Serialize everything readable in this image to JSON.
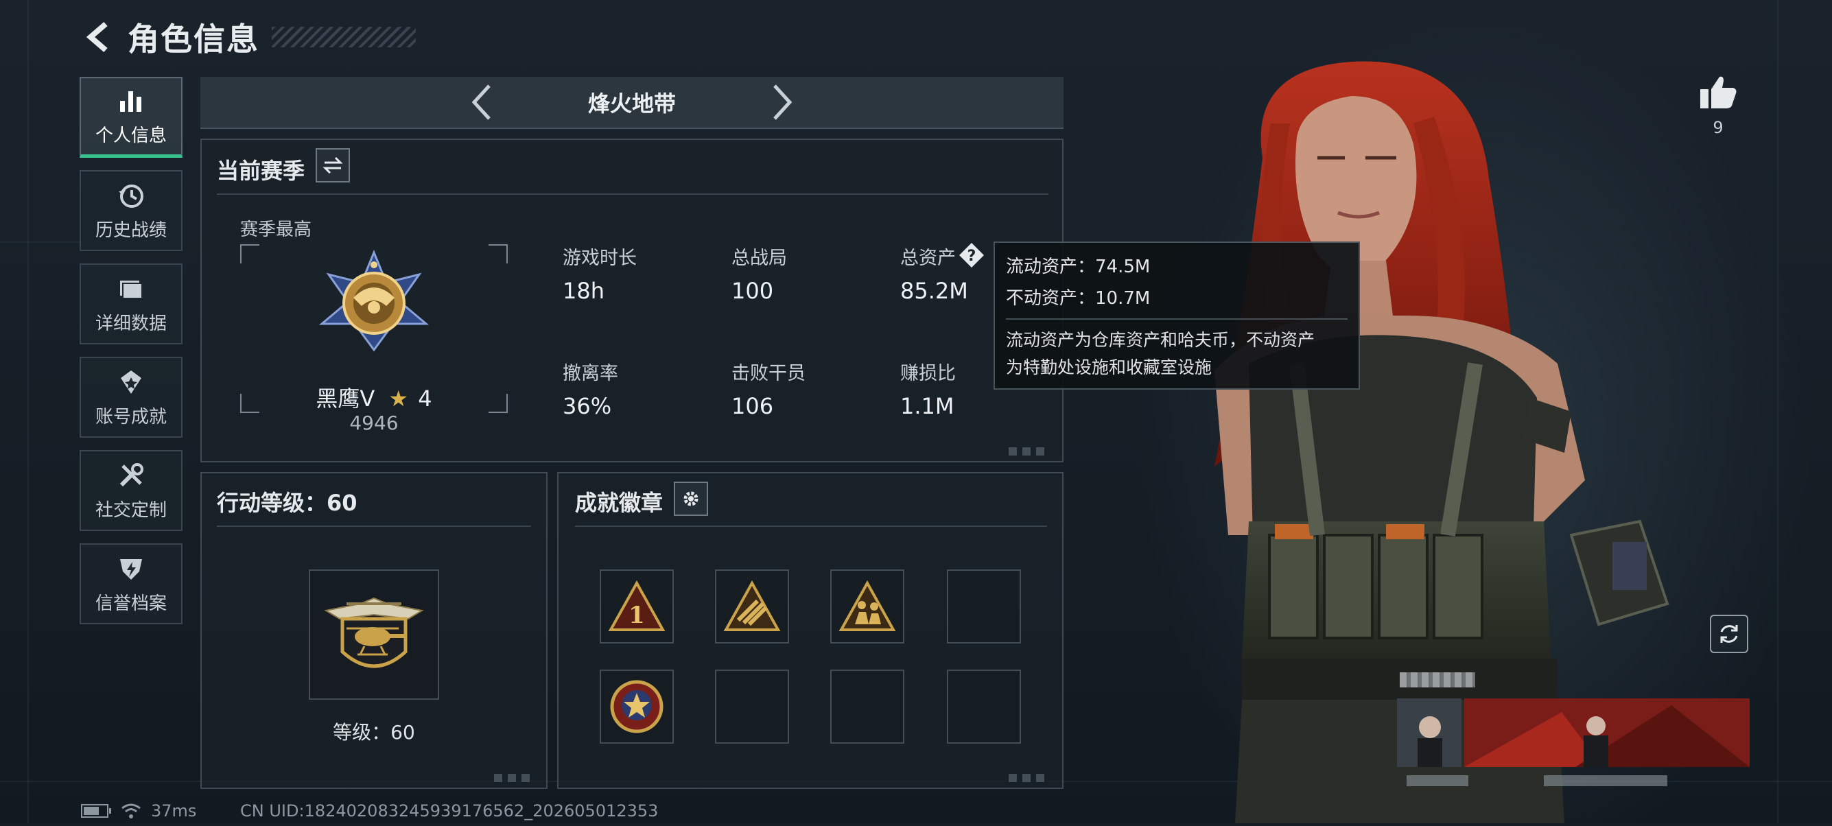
{
  "header": {
    "title": "角色信息"
  },
  "nav": {
    "items": [
      {
        "label": "个人信息",
        "icon": "bar-chart-icon",
        "active": true
      },
      {
        "label": "历史战绩",
        "icon": "history-icon"
      },
      {
        "label": "详细数据",
        "icon": "folder-icon"
      },
      {
        "label": "账号成就",
        "icon": "achievement-icon"
      },
      {
        "label": "社交定制",
        "icon": "tools-icon"
      },
      {
        "label": "信誉档案",
        "icon": "shield-icon"
      }
    ]
  },
  "mode": {
    "name": "烽火地带"
  },
  "season": {
    "title": "当前赛季",
    "best_label": "赛季最高",
    "rank_name": "黑鹰V",
    "rank_stars": "4",
    "rank_score": "4946",
    "stats": [
      {
        "label": "游戏时长",
        "value": "18h"
      },
      {
        "label": "总战局",
        "value": "100"
      },
      {
        "label": "总资产",
        "value": "85.2M"
      },
      {
        "label": "撤离率",
        "value": "36%"
      },
      {
        "label": "击败干员",
        "value": "106"
      },
      {
        "label": "赚损比",
        "value": "1.1M"
      }
    ]
  },
  "tooltip": {
    "liquid": "流动资产：74.5M",
    "fixed": "不动资产：10.7M",
    "desc_line1": "流动资产为仓库资产和哈夫币，不动资产",
    "desc_line2": "为特勤处设施和收藏室设施"
  },
  "level": {
    "title": "行动等级：60",
    "text": "等级：60"
  },
  "badges": {
    "title": "成就徽章",
    "filled": 4,
    "total": 8
  },
  "likes": {
    "count": "9"
  },
  "footer": {
    "ping": "37ms",
    "uid": "CN UID:18240208324593917656​2_202605012353"
  },
  "colors": {
    "accent": "#37c58d",
    "gold": "#c9a24a",
    "tooltip_bg": "#0e1216"
  }
}
